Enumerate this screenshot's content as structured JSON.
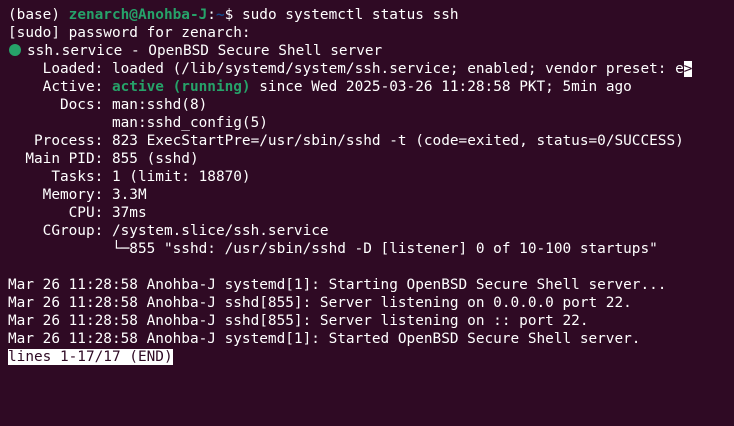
{
  "prompt": {
    "env": "(base)",
    "user_host": "zenarch@Anohba-J",
    "sep": ":",
    "path": "~",
    "symbol": "$",
    "command": " sudo systemctl status ssh"
  },
  "sudo_prompt": "[sudo] password for zenarch:",
  "service": {
    "title": "ssh.service - OpenBSD Secure Shell server",
    "loaded_label": "    Loaded:",
    "loaded_value": " loaded (/lib/systemd/system/ssh.service; enabled; vendor preset: e",
    "trunc_marker": ">",
    "active_label": "    Active:",
    "active_state": " active (running)",
    "active_since": " since Wed 2025-03-26 11:28:58 PKT; 5min ago",
    "docs_label": "      Docs:",
    "docs_1": " man:sshd(8)",
    "docs_2": "            man:sshd_config(5)",
    "process_label": "   Process:",
    "process_value": " 823 ExecStartPre=/usr/sbin/sshd -t (code=exited, status=0/SUCCESS)",
    "mainpid_label": "  Main PID:",
    "mainpid_value": " 855 (sshd)",
    "tasks_label": "     Tasks:",
    "tasks_value": " 1 (limit: 18870)",
    "memory_label": "    Memory:",
    "memory_value": " 3.3M",
    "cpu_label": "       CPU:",
    "cpu_value": " 37ms",
    "cgroup_label": "    CGroup:",
    "cgroup_value": " /system.slice/ssh.service",
    "cgroup_child": "            └─855 \"sshd: /usr/sbin/sshd -D [listener] 0 of 10-100 startups\""
  },
  "logs": [
    "Mar 26 11:28:58 Anohba-J systemd[1]: Starting OpenBSD Secure Shell server...",
    "Mar 26 11:28:58 Anohba-J sshd[855]: Server listening on 0.0.0.0 port 22.",
    "Mar 26 11:28:58 Anohba-J sshd[855]: Server listening on :: port 22.",
    "Mar 26 11:28:58 Anohba-J systemd[1]: Started OpenBSD Secure Shell server."
  ],
  "pager_status": "lines 1-17/17 (END)",
  "colors": {
    "background": "#2f0a24",
    "green": "#26a269",
    "blue": "#12488b",
    "text": "#ffffff"
  }
}
